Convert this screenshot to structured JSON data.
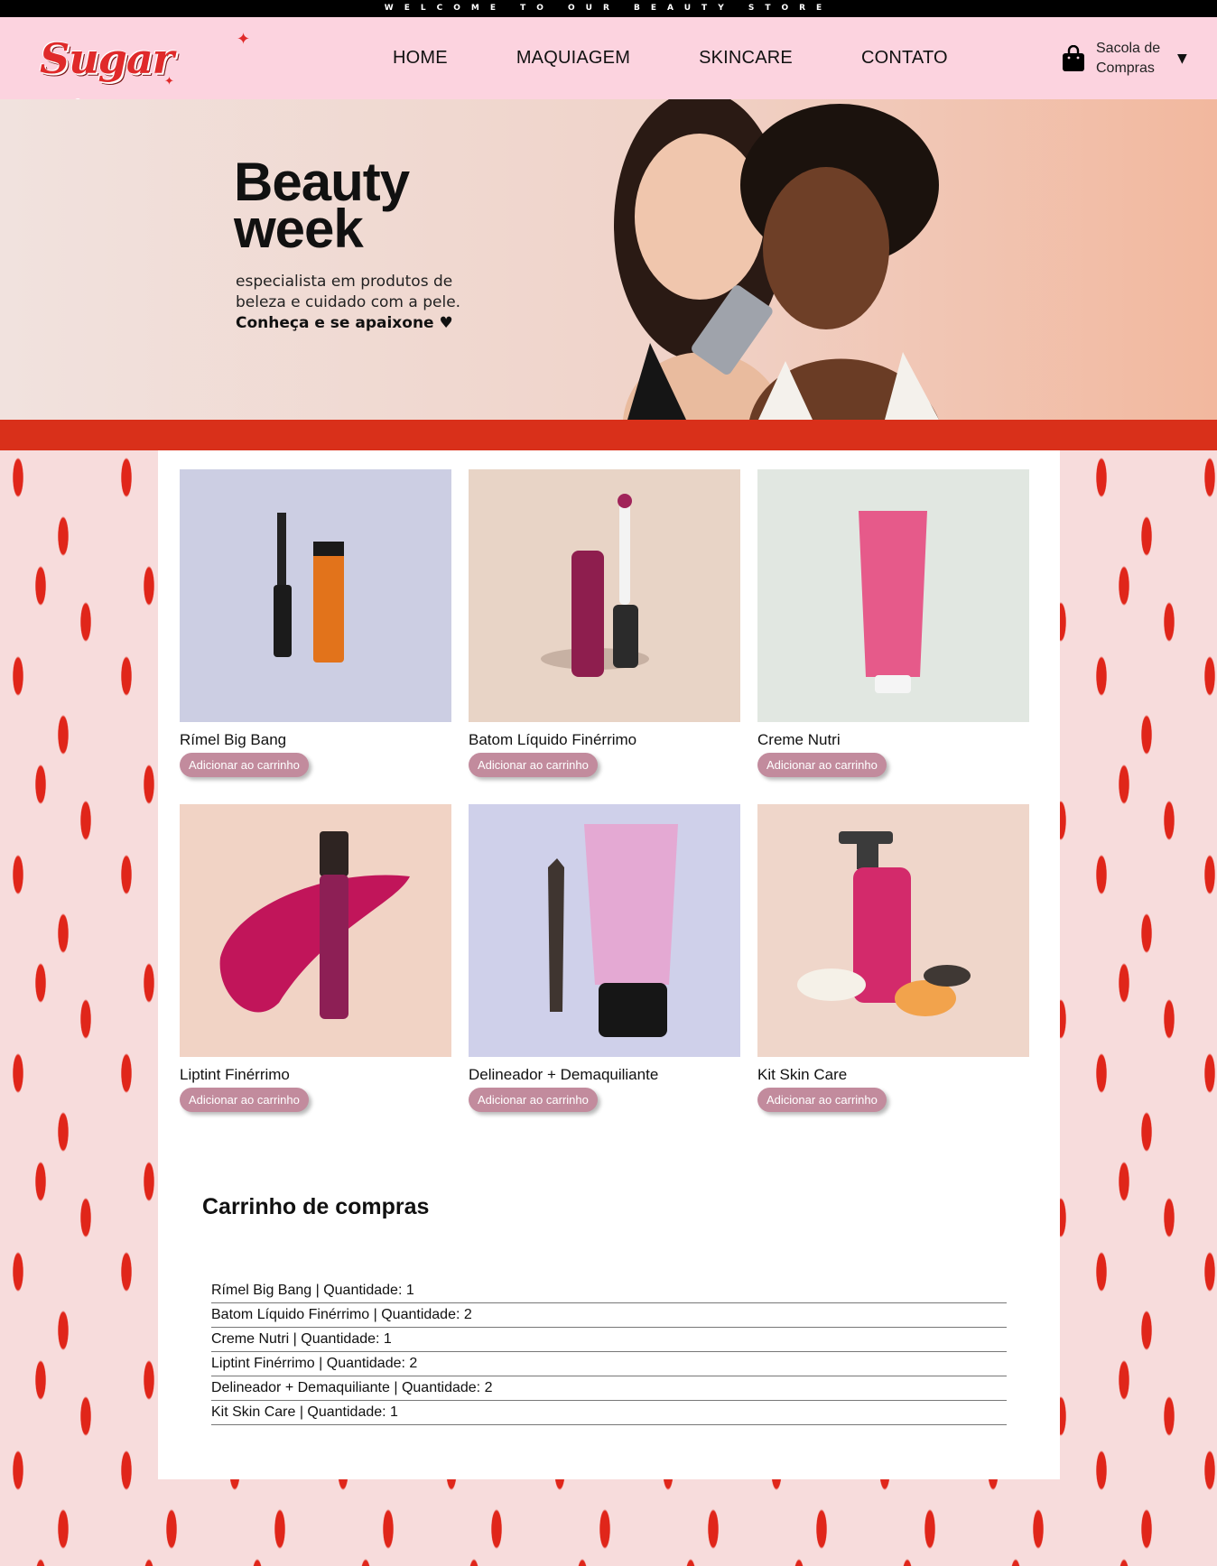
{
  "top_strip": {
    "text": "WELCOME TO OUR BEAUTY STORE"
  },
  "header": {
    "logo_text": "Sugar Lips",
    "nav": [
      "HOME",
      "MAQUIAGEM",
      "SKINCARE",
      "CONTATO"
    ],
    "cart_label_line1": "Sacola de",
    "cart_label_line2": "Compras"
  },
  "hero": {
    "title_line1": "Beauty",
    "title_line2": "week",
    "text_line1": "especialista em produtos de",
    "text_line2": "beleza e cuidado com a pele.",
    "text_strong": "Conheça e se apaixone"
  },
  "products": [
    {
      "name": "Rímel Big Bang",
      "button": "Adicionar ao carrinho",
      "bg": "#cccee3"
    },
    {
      "name": "Batom Líquido Finérrimo",
      "button": "Adicionar ao carrinho",
      "bg": "#e8d4c6"
    },
    {
      "name": "Creme Nutri",
      "button": "Adicionar ao carrinho",
      "bg": "#e1e7e1"
    },
    {
      "name": "Liptint Finérrimo",
      "button": "Adicionar ao carrinho",
      "bg": "#f1d3c5"
    },
    {
      "name": "Delineador + Demaquiliante",
      "button": "Adicionar ao carrinho",
      "bg": "#cfd0ea"
    },
    {
      "name": "Kit Skin Care",
      "button": "Adicionar ao carrinho",
      "bg": "#efd6ca"
    }
  ],
  "cart": {
    "title": "Carrinho de compras",
    "items": [
      "Rímel Big Bang | Quantidade: 1",
      "Batom Líquido Finérrimo | Quantidade: 2",
      "Creme Nutri | Quantidade: 1",
      "Liptint Finérrimo | Quantidade: 2",
      "Delineador + Demaquiliante | Quantidade: 2",
      "Kit Skin Care | Quantidade: 1"
    ]
  },
  "colors": {
    "header_bg": "#fcd3df",
    "accent_red": "#d9301a",
    "button_bg": "#c28b9d"
  }
}
